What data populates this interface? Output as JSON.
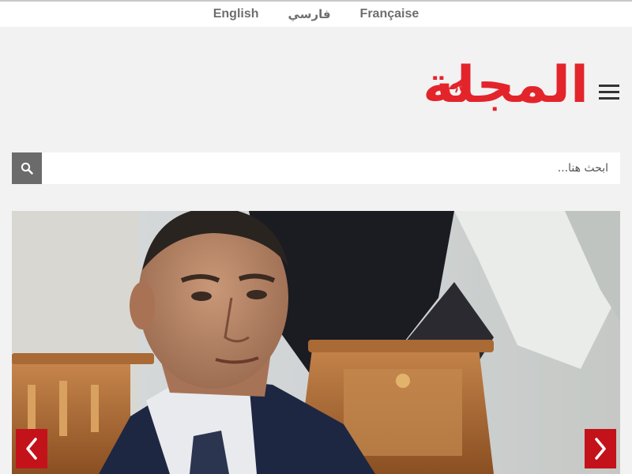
{
  "languages": {
    "english": "English",
    "farsi": "فارسي",
    "french": "Française"
  },
  "logo": {
    "text": "المجلة",
    "color": "#e3242b"
  },
  "menu": {
    "icon": "hamburger-menu-icon"
  },
  "search": {
    "placeholder": "ابحث هنا...",
    "value": "",
    "icon": "search-icon"
  },
  "slider": {
    "image": "photo-man-in-suit-with-flag",
    "prev_icon": "chevron-left-icon",
    "next_icon": "chevron-right-icon",
    "arrow_color": "#c4121b"
  }
}
